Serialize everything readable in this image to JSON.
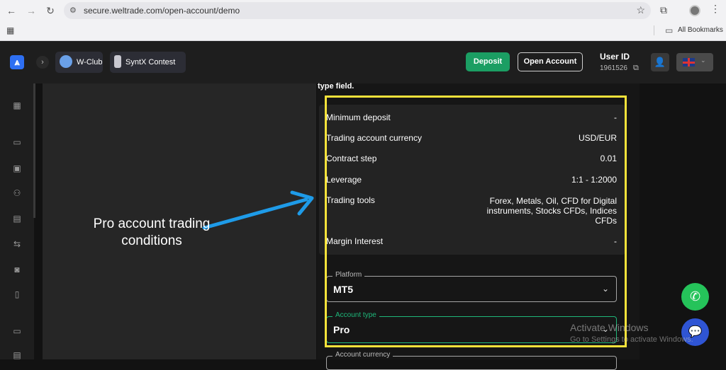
{
  "browser": {
    "url": "secure.weltrade.com/open-account/demo",
    "bookmarks_label": "All Bookmarks"
  },
  "header": {
    "chips": [
      {
        "label": "W-Club",
        "icon": "globe-icon"
      },
      {
        "label": "SyntX Contest",
        "icon": "trophy-icon"
      }
    ],
    "deposit_label": "Deposit",
    "open_account_label": "Open Account",
    "user_id_label": "User ID",
    "user_id_value": "1961526",
    "language_flag": "uk-flag-icon"
  },
  "form": {
    "intro_text": "type field.",
    "conditions": [
      {
        "label": "Minimum deposit",
        "value": "-"
      },
      {
        "label": "Trading account currency",
        "value": "USD/EUR"
      },
      {
        "label": "Contract step",
        "value": "0.01"
      },
      {
        "label": "Leverage",
        "value": "1:1 - 1:2000"
      },
      {
        "label": "Trading tools",
        "value": "Forex, Metals, Oil, CFD for Digital instruments, Stocks CFDs, Indices CFDs"
      },
      {
        "label": "Margin Interest",
        "value": "-"
      }
    ],
    "platform": {
      "legend": "Platform",
      "value": "MT5"
    },
    "account_type": {
      "legend": "Account type",
      "value": "Pro"
    },
    "account_currency": {
      "legend": "Account currency"
    }
  },
  "annotation": {
    "text": "Pro account trading conditions",
    "color": "#f6e23a",
    "arrow_color": "#1e9be8"
  },
  "watermark": {
    "title": "Activate Windows",
    "subtitle": "Go to Settings to activate Windows."
  },
  "colors": {
    "accent_green": "#1b9e63",
    "field_focus": "#1eb87a"
  }
}
